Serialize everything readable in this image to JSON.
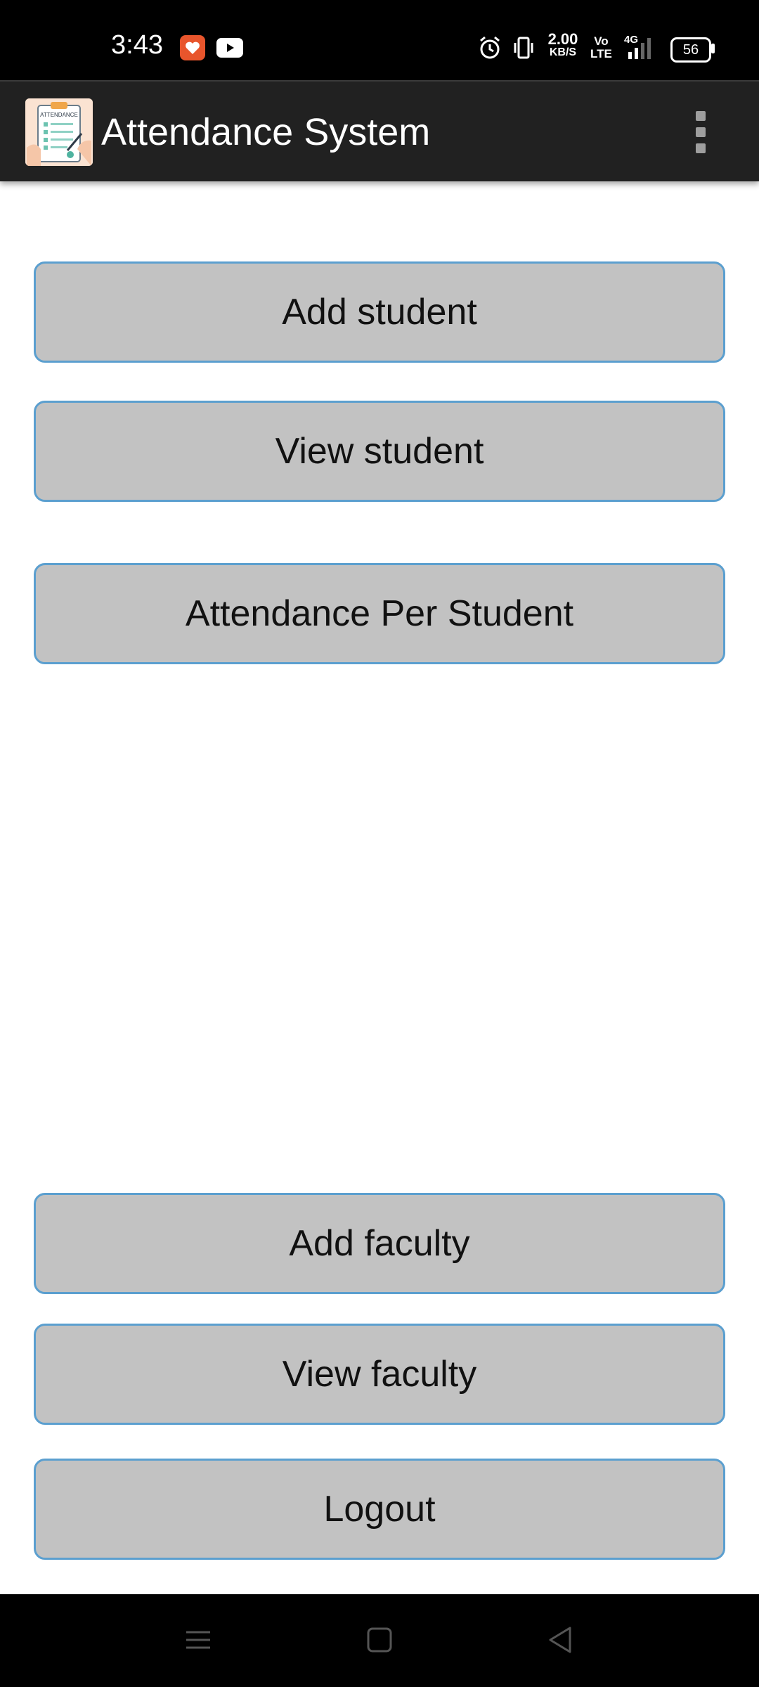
{
  "status_bar": {
    "time": "3:43",
    "net_speed_value": "2.00",
    "net_speed_unit": "KB/S",
    "volte_top": "Vo",
    "volte_bottom": "LTE",
    "network_type": "4G",
    "battery_level": "56",
    "icons": [
      "heart-notification-icon",
      "youtube-icon",
      "alarm-icon",
      "vibrate-icon",
      "signal-icon",
      "battery-icon"
    ]
  },
  "app_bar": {
    "title": "Attendance System",
    "logo_text": "ATTENDANCE",
    "menu_icon": "more-vert-icon"
  },
  "buttons": {
    "add_student": "Add student",
    "view_student": "View student",
    "attendance_per_student": "Attendance Per Student",
    "add_faculty": "Add faculty",
    "view_faculty": "View faculty",
    "logout": "Logout"
  },
  "nav_bar": {
    "icons": [
      "menu-icon",
      "home-icon",
      "back-icon"
    ]
  },
  "colors": {
    "app_bar": "#212121",
    "button_fill": "#c2c2c2",
    "button_border": "#5b9fcf",
    "background": "#ffffff"
  }
}
